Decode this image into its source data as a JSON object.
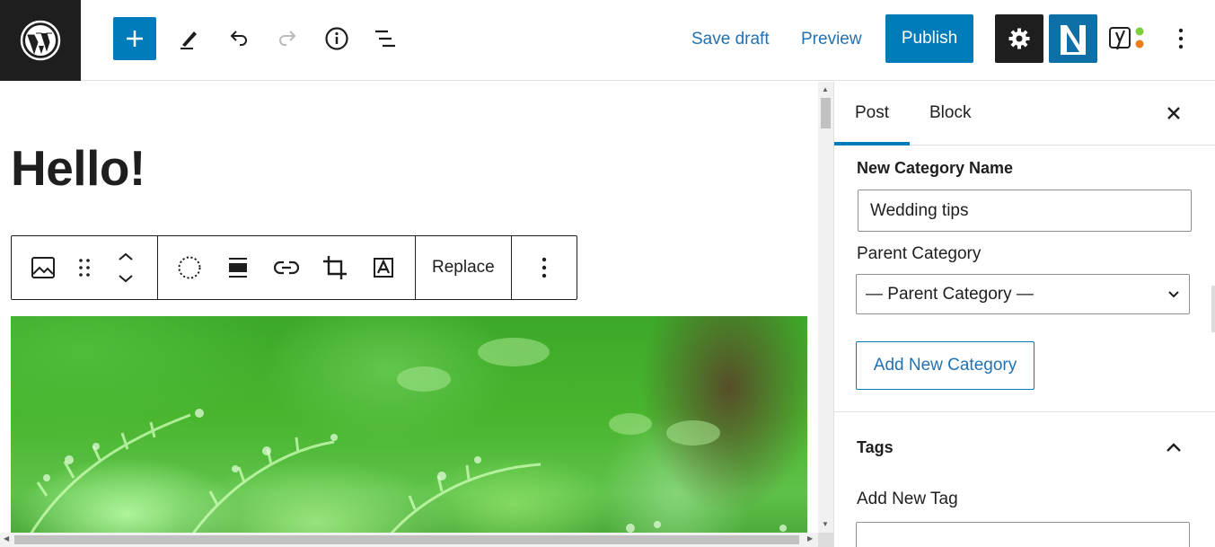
{
  "toolbar": {
    "save_draft": "Save draft",
    "preview": "Preview",
    "publish": "Publish",
    "icons": [
      "wordpress-logo",
      "plus-icon",
      "pencil-icon",
      "undo-icon",
      "redo-icon",
      "info-icon",
      "list-view-icon",
      "gear-icon",
      "n-plugin-icon",
      "yoast-icon",
      "more-vertical-icon"
    ]
  },
  "editor": {
    "title": "Hello!",
    "block_toolbar": {
      "replace": "Replace",
      "icons": [
        "image-icon",
        "drag-handle-icon",
        "move-up-down-icon",
        "circle-dotted-icon",
        "align-icon",
        "link-icon",
        "crop-icon",
        "text-overlay-icon",
        "more-vertical-icon"
      ]
    }
  },
  "sidebar": {
    "tabs": [
      {
        "label": "Post",
        "active": true
      },
      {
        "label": "Block",
        "active": false
      }
    ],
    "new_category_name_label": "New Category Name",
    "new_category_name_value": "Wedding tips",
    "parent_category_label": "Parent Category",
    "parent_category_selected": "— Parent Category —",
    "add_new_category": "Add New Category",
    "tags_heading": "Tags",
    "add_new_tag_label": "Add New Tag"
  },
  "colors": {
    "accent": "#007cba",
    "dark": "#1e1e1e",
    "link": "#2271b1"
  }
}
